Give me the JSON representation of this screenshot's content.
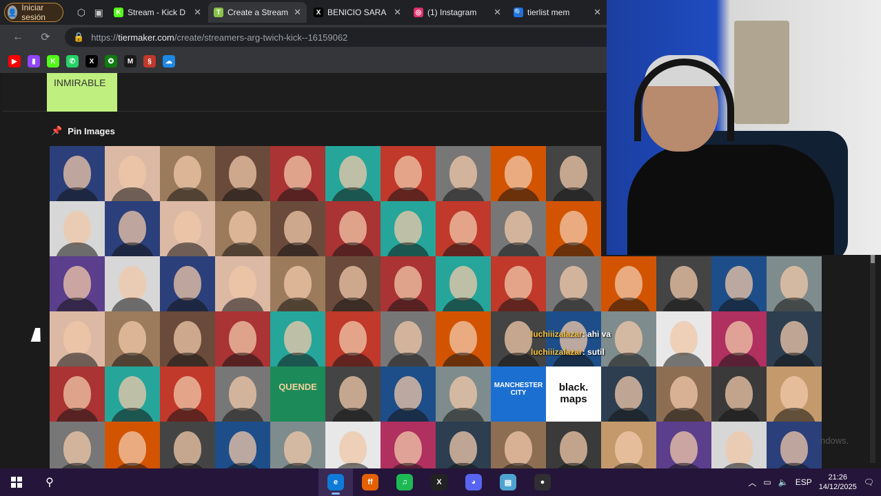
{
  "browser": {
    "profile_label": "Iniciar sesión",
    "tabs": [
      {
        "title": "Stream - Kick D",
        "favicon": "K",
        "color": "#53fc18",
        "active": false
      },
      {
        "title": "Create a Stream",
        "favicon": "T",
        "color": "#8bc34a",
        "active": true
      },
      {
        "title": "BENICIO SARA",
        "favicon": "X",
        "color": "#000000",
        "active": false
      },
      {
        "title": "(1) Instagram",
        "favicon": "◎",
        "color": "#e1306c",
        "active": false
      },
      {
        "title": "tierlist mem",
        "favicon": "🔍",
        "color": "#1a73e8",
        "active": false
      }
    ],
    "url_prefix": "https://",
    "url_host": "tiermaker.com",
    "url_path": "/create/streamers-arg-twich-kick--16159062",
    "bookmarks": [
      {
        "name": "youtube",
        "glyph": "▶",
        "color": "#ff0000"
      },
      {
        "name": "twitch",
        "glyph": "▮",
        "color": "#9146ff"
      },
      {
        "name": "kick",
        "glyph": "K",
        "color": "#53fc18"
      },
      {
        "name": "whatsapp",
        "glyph": "✆",
        "color": "#25d366"
      },
      {
        "name": "x",
        "glyph": "X",
        "color": "#000000"
      },
      {
        "name": "xbox",
        "glyph": "✪",
        "color": "#107c10"
      },
      {
        "name": "medium",
        "glyph": "M",
        "color": "#1a1a1a"
      },
      {
        "name": "app",
        "glyph": "§",
        "color": "#c0392b"
      },
      {
        "name": "cloud",
        "glyph": "☁",
        "color": "#1e88e5"
      }
    ]
  },
  "tiermaker": {
    "tier_label": "INMIRABLE",
    "pin_label": "Pin Images",
    "pinned_cells_text": {
      "logo_1": "QUENDE",
      "logo_2": "MANCHESTER CITY",
      "logo_3": "black. maps"
    }
  },
  "webcam_chat": [
    {
      "user": "luchiiizalazar",
      "message": ": ahi va"
    },
    {
      "user": "luchiiizalazar",
      "message": ": sutil"
    }
  ],
  "watermark": "ndows.",
  "taskbar": {
    "apps": [
      {
        "name": "edge",
        "glyph": "e",
        "color": "#0f7bd8",
        "active": true
      },
      {
        "name": "firefox",
        "glyph": "ff",
        "color": "#e66000",
        "active": false
      },
      {
        "name": "spotify",
        "glyph": "♫",
        "color": "#1db954",
        "active": false
      },
      {
        "name": "xsplit",
        "glyph": "X",
        "color": "#222222",
        "active": false
      },
      {
        "name": "discord",
        "glyph": "◕",
        "color": "#5865f2",
        "active": false
      },
      {
        "name": "notes",
        "glyph": "▤",
        "color": "#4fa3d1",
        "active": false
      },
      {
        "name": "obs",
        "glyph": "●",
        "color": "#302e31",
        "active": false
      }
    ],
    "language": "ESP",
    "time": "21:26",
    "date": "14/12/2025"
  }
}
